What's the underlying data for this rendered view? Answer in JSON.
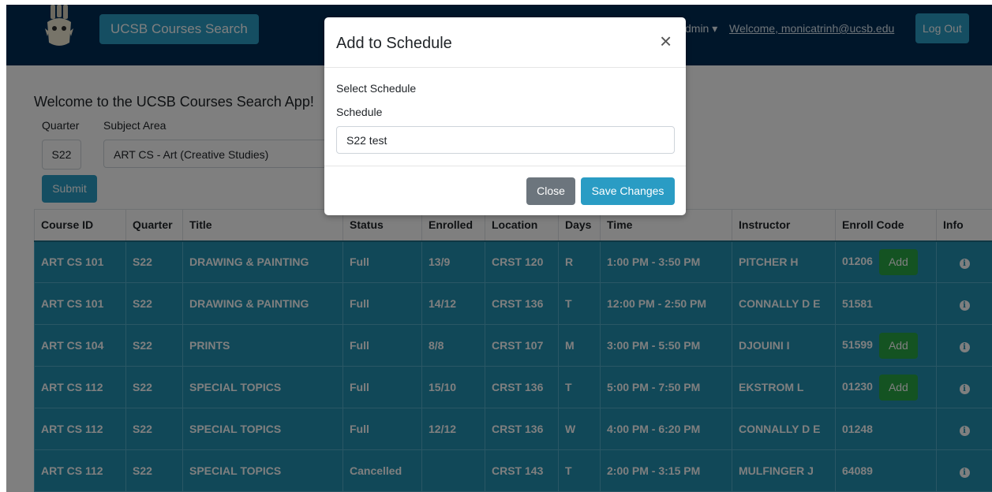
{
  "navbar": {
    "brand": "UCSB Courses Search",
    "admin_partial": "dmin ▾",
    "welcome": "Welcome, monicatrinh@ucsb.edu",
    "logout": "Log Out"
  },
  "main": {
    "welcome_title": "Welcome to the UCSB Courses Search App!",
    "quarter_label": "Quarter",
    "subject_label": "Subject Area",
    "quarter_value": "S22",
    "subject_value": "ART CS - Art (Creative Studies)",
    "submit_label": "Submit"
  },
  "table": {
    "headers": [
      "Course ID",
      "Quarter",
      "Title",
      "Status",
      "Enrolled",
      "Location",
      "Days",
      "Time",
      "Instructor",
      "Enroll Code",
      "Info"
    ],
    "rows": [
      {
        "course_id": "ART CS 101",
        "quarter": "S22",
        "title": "DRAWING & PAINTING",
        "status": "Full",
        "enrolled": "13/9",
        "location": "CRST 120",
        "days": "R",
        "time": "1:00 PM - 3:50 PM",
        "instructor": "PITCHER H",
        "enroll_code": "01206",
        "add": "Add"
      },
      {
        "course_id": "ART CS 101",
        "quarter": "S22",
        "title": "DRAWING & PAINTING",
        "status": "Full",
        "enrolled": "14/12",
        "location": "CRST 136",
        "days": "T",
        "time": "12:00 PM - 2:50 PM",
        "instructor": "CONNALLY D E",
        "enroll_code": "51581",
        "add": ""
      },
      {
        "course_id": "ART CS 104",
        "quarter": "S22",
        "title": "PRINTS",
        "status": "Full",
        "enrolled": "8/8",
        "location": "CRST 107",
        "days": "M",
        "time": "3:00 PM - 5:50 PM",
        "instructor": "DJOUINI I",
        "enroll_code": "51599",
        "add": "Add"
      },
      {
        "course_id": "ART CS 112",
        "quarter": "S22",
        "title": "SPECIAL TOPICS",
        "status": "Full",
        "enrolled": "15/10",
        "location": "CRST 136",
        "days": "T",
        "time": "5:00 PM - 7:50 PM",
        "instructor": "EKSTROM L",
        "enroll_code": "01230",
        "add": "Add"
      },
      {
        "course_id": "ART CS 112",
        "quarter": "S22",
        "title": "SPECIAL TOPICS",
        "status": "Full",
        "enrolled": "12/12",
        "location": "CRST 136",
        "days": "W",
        "time": "4:00 PM - 6:20 PM",
        "instructor": "CONNALLY D E",
        "enroll_code": "01248",
        "add": ""
      },
      {
        "course_id": "ART CS 112",
        "quarter": "S22",
        "title": "SPECIAL TOPICS",
        "status": "Cancelled",
        "enrolled": "",
        "location": "CRST 143",
        "days": "T",
        "time": "2:00 PM - 3:15 PM",
        "instructor": "MULFINGER J",
        "enroll_code": "64089",
        "add": ""
      }
    ]
  },
  "modal": {
    "title": "Add to Schedule",
    "close_symbol": "×",
    "section_label": "Select Schedule",
    "field_label": "Schedule",
    "selected_schedule": "S22 test",
    "close_label": "Close",
    "save_label": "Save Changes"
  },
  "colors": {
    "navbar": "#002D55",
    "accent": "#2a9cc4",
    "row_bg": "#2390b0",
    "add_green": "#28a745"
  },
  "icons": [
    "logo-mascot-icon",
    "caret-down-icon",
    "info-icon",
    "close-icon"
  ]
}
